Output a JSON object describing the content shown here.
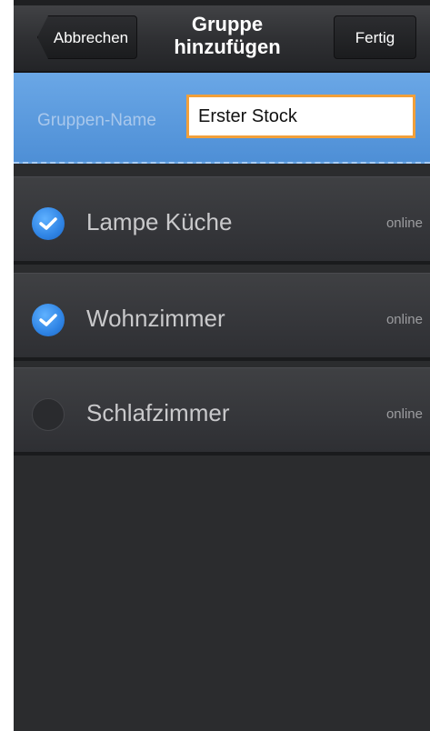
{
  "header": {
    "cancel_label": "Abbrechen",
    "title_line1": "Gruppe",
    "title_line2": "hinzufügen",
    "done_label": "Fertig"
  },
  "group_name": {
    "label": "Gruppen-Name",
    "value": "Erster Stock"
  },
  "devices": [
    {
      "name": "Lampe Küche",
      "status": "online",
      "selected": true
    },
    {
      "name": "Wohnzimmer",
      "status": "online",
      "selected": true
    },
    {
      "name": "Schlafzimmer",
      "status": "online",
      "selected": false
    }
  ],
  "colors": {
    "accent_blue": "#4e8fd6",
    "input_border": "#f2a03a",
    "background": "#2b2c2e"
  }
}
